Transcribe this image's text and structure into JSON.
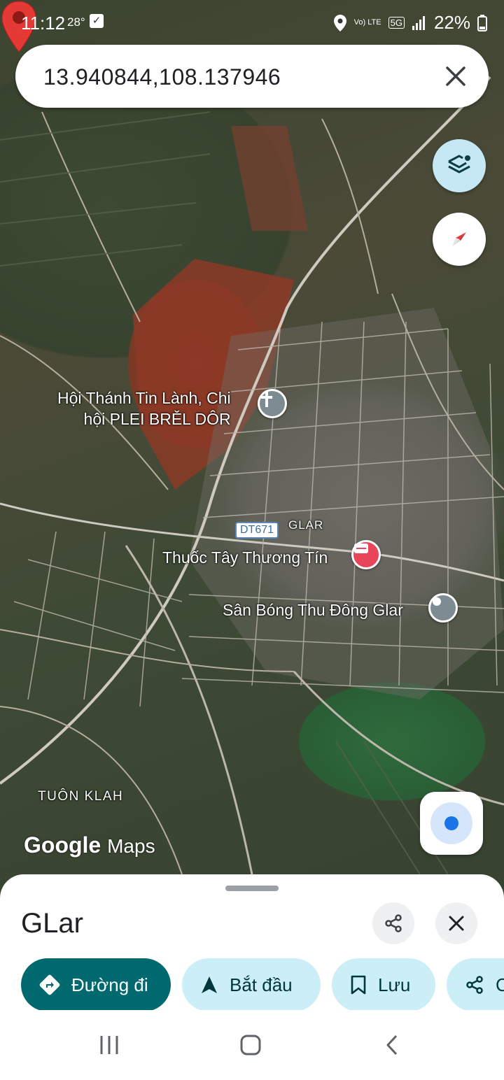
{
  "status_bar": {
    "time": "11:12",
    "temperature": "28°",
    "network_label_volte": "Vo) LTE",
    "network_5g": "5G",
    "battery": "22%"
  },
  "search": {
    "query": "13.940844,108.137946"
  },
  "map": {
    "labels": {
      "church_line1": "Hội Thánh Tin Lành, Chi",
      "church_line2": "hội PLEI BRĚL DÔR",
      "pharmacy": "Thuốc Tây Thương Tín",
      "stadium": "Sân Bóng Thu Đông Glar",
      "village_glar": "GLAR",
      "village_tuon": "TUÔN KLAH",
      "road": "DT671"
    },
    "brand_google": "Google",
    "brand_maps": "Maps"
  },
  "sheet": {
    "title": "GLar",
    "actions": {
      "directions": "Đường đi",
      "start": "Bắt đầu",
      "save": "Lưu",
      "share": "C"
    }
  },
  "colors": {
    "primary_chip": "#00686f",
    "secondary_chip": "#cbeef7",
    "pin": "#e53935",
    "location_dot": "#1a73e8"
  }
}
